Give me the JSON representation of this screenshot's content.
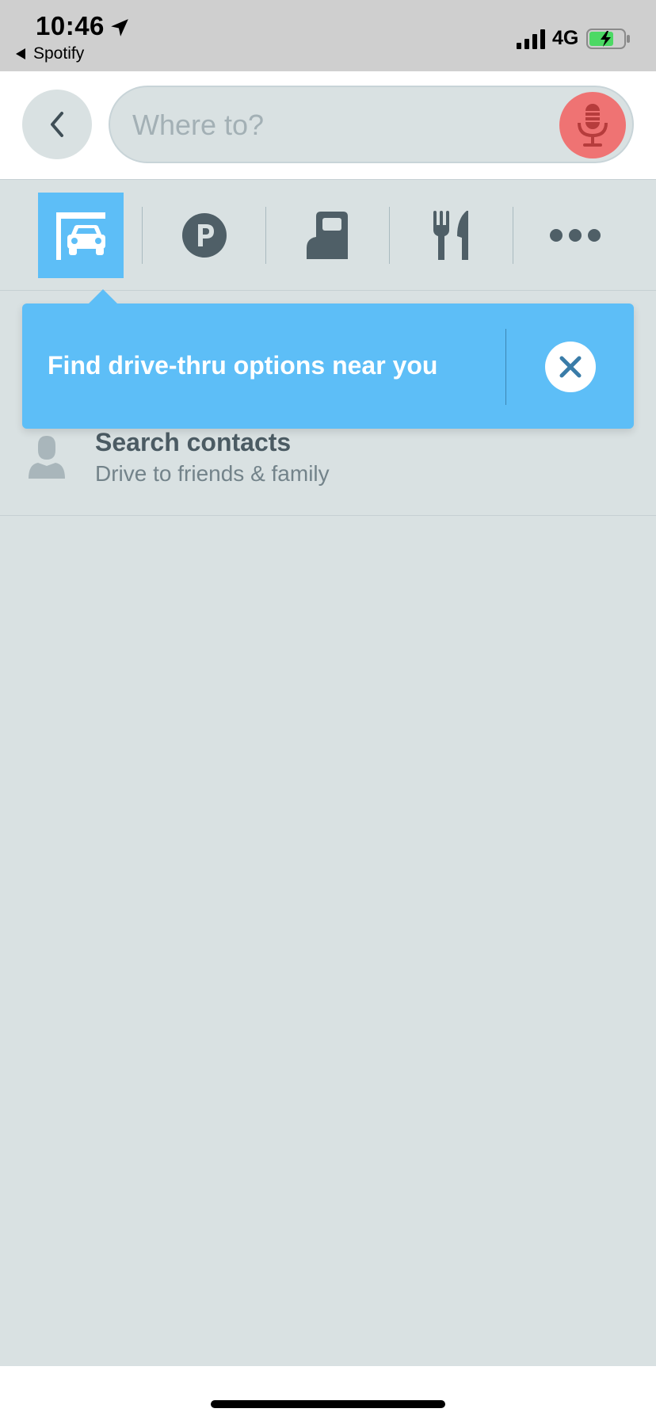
{
  "status_bar": {
    "time": "10:46",
    "back_app": "Spotify",
    "network": "4G"
  },
  "header": {
    "search_placeholder": "Where to?",
    "back_icon": "chevron-left-icon",
    "mic_icon": "microphone-icon",
    "mic_color": "#ef7373"
  },
  "categories": [
    {
      "name": "drive-thru",
      "icon": "drive-thru-car-icon",
      "active": true
    },
    {
      "name": "parking",
      "icon": "parking-icon",
      "active": false
    },
    {
      "name": "gas",
      "icon": "gas-pump-icon",
      "active": false
    },
    {
      "name": "food",
      "icon": "fork-knife-icon",
      "active": false
    },
    {
      "name": "more",
      "icon": "more-dots-icon",
      "active": false
    }
  ],
  "tooltip": {
    "text": "Find drive-thru options near you",
    "close_icon": "close-icon",
    "color": "#5dbef7"
  },
  "list": [
    {
      "title": "Search contacts",
      "subtitle": "Drive to friends & family",
      "icon": "person-icon"
    }
  ]
}
